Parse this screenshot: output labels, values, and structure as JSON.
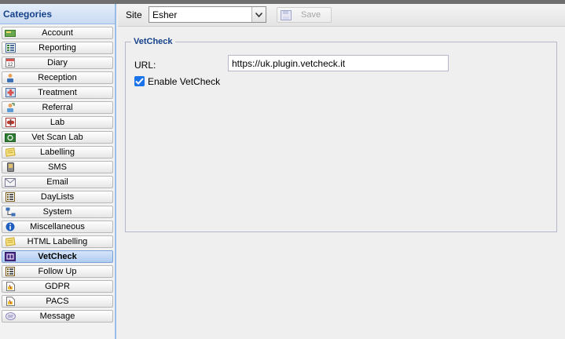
{
  "sidebar": {
    "title": "Categories",
    "items": [
      {
        "label": "Account",
        "icon": "money-icon",
        "active": false
      },
      {
        "label": "Reporting",
        "icon": "report-icon",
        "active": false
      },
      {
        "label": "Diary",
        "icon": "calendar-icon",
        "active": false
      },
      {
        "label": "Reception",
        "icon": "person-icon",
        "active": false
      },
      {
        "label": "Treatment",
        "icon": "medical-icon",
        "active": false
      },
      {
        "label": "Referral",
        "icon": "referral-icon",
        "active": false
      },
      {
        "label": "Lab",
        "icon": "lab-icon",
        "active": false
      },
      {
        "label": "Vet Scan Lab",
        "icon": "scan-icon",
        "active": false
      },
      {
        "label": "Labelling",
        "icon": "label-icon",
        "active": false
      },
      {
        "label": "SMS",
        "icon": "phone-icon",
        "active": false
      },
      {
        "label": "Email",
        "icon": "envelope-icon",
        "active": false
      },
      {
        "label": "DayLists",
        "icon": "list-icon",
        "active": false
      },
      {
        "label": "System",
        "icon": "network-icon",
        "active": false
      },
      {
        "label": "Miscellaneous",
        "icon": "info-icon",
        "active": false
      },
      {
        "label": "HTML Labelling",
        "icon": "label-icon",
        "active": false
      },
      {
        "label": "VetCheck",
        "icon": "vetcheck-icon",
        "active": true
      },
      {
        "label": "Follow Up",
        "icon": "list-icon",
        "active": false
      },
      {
        "label": "GDPR",
        "icon": "document-icon",
        "active": false
      },
      {
        "label": "PACS",
        "icon": "document-icon",
        "active": false
      },
      {
        "label": "Message",
        "icon": "message-icon",
        "active": false
      }
    ]
  },
  "toolbar": {
    "site_label": "Site",
    "site_value": "Esher",
    "save_label": "Save"
  },
  "form": {
    "legend": "VetCheck",
    "url_label": "URL:",
    "url_value": "https://uk.plugin.vetcheck.it",
    "enable_label": "Enable VetCheck",
    "enable_checked": true
  },
  "colors": {
    "accent": "#15428b",
    "checkbox": "#1a73e8",
    "active_item": "#aecbf0"
  }
}
